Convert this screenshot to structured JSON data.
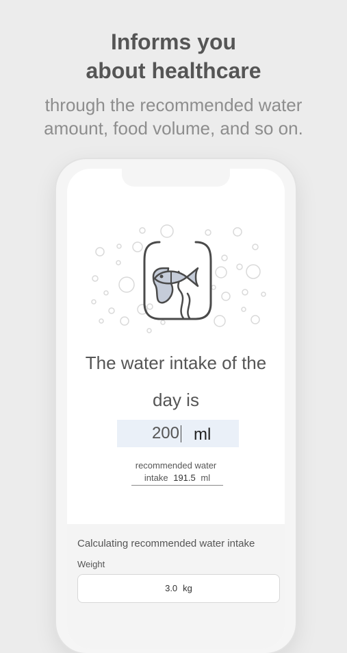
{
  "header": {
    "title_line1": "Informs you",
    "title_line2": "about healthcare",
    "subtitle_line1": "through the recommended water",
    "subtitle_line2": "amount, food volume, and so on."
  },
  "app": {
    "illustration_icon": "fish-bowl-icon",
    "intake": {
      "label_line1": "The water intake of the",
      "label_line2": "day is",
      "value": "200",
      "unit": "ml"
    },
    "recommended": {
      "label_line1": "recommended water",
      "label_line2": "intake",
      "value": "191.5",
      "unit": "ml"
    },
    "calculator": {
      "title": "Calculating recommended water intake",
      "weight_label": "Weight",
      "weight_value": "3.0",
      "weight_unit": "kg"
    }
  },
  "colors": {
    "background": "#ececec",
    "input_highlight": "#eaf0f8",
    "icon_fill": "#c5ccd9"
  }
}
